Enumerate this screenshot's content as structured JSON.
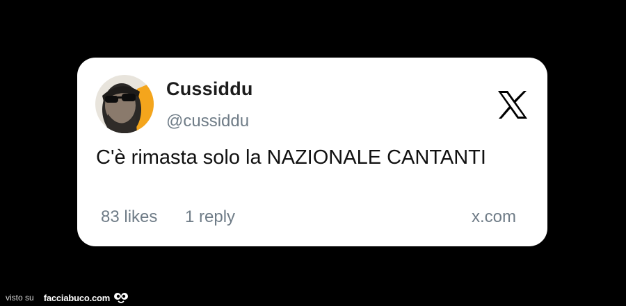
{
  "tweet": {
    "display_name": "Cussiddu",
    "handle": "@cussiddu",
    "text": "C'è rimasta solo la NAZIONALE CANTANTI",
    "likes": "83 likes",
    "replies": "1 reply",
    "source": "x.com",
    "platform_icon": "x-logo-icon",
    "avatar_icon": "profile-photo"
  },
  "watermark": {
    "prefix": "visto su",
    "site": "facciabuco.com",
    "logo_icon": "googly-eyes-icon"
  },
  "colors": {
    "background": "#000000",
    "card": "#ffffff",
    "name": "#1c1c1c",
    "secondary_text": "#6f7c87",
    "body_text": "#111111"
  }
}
